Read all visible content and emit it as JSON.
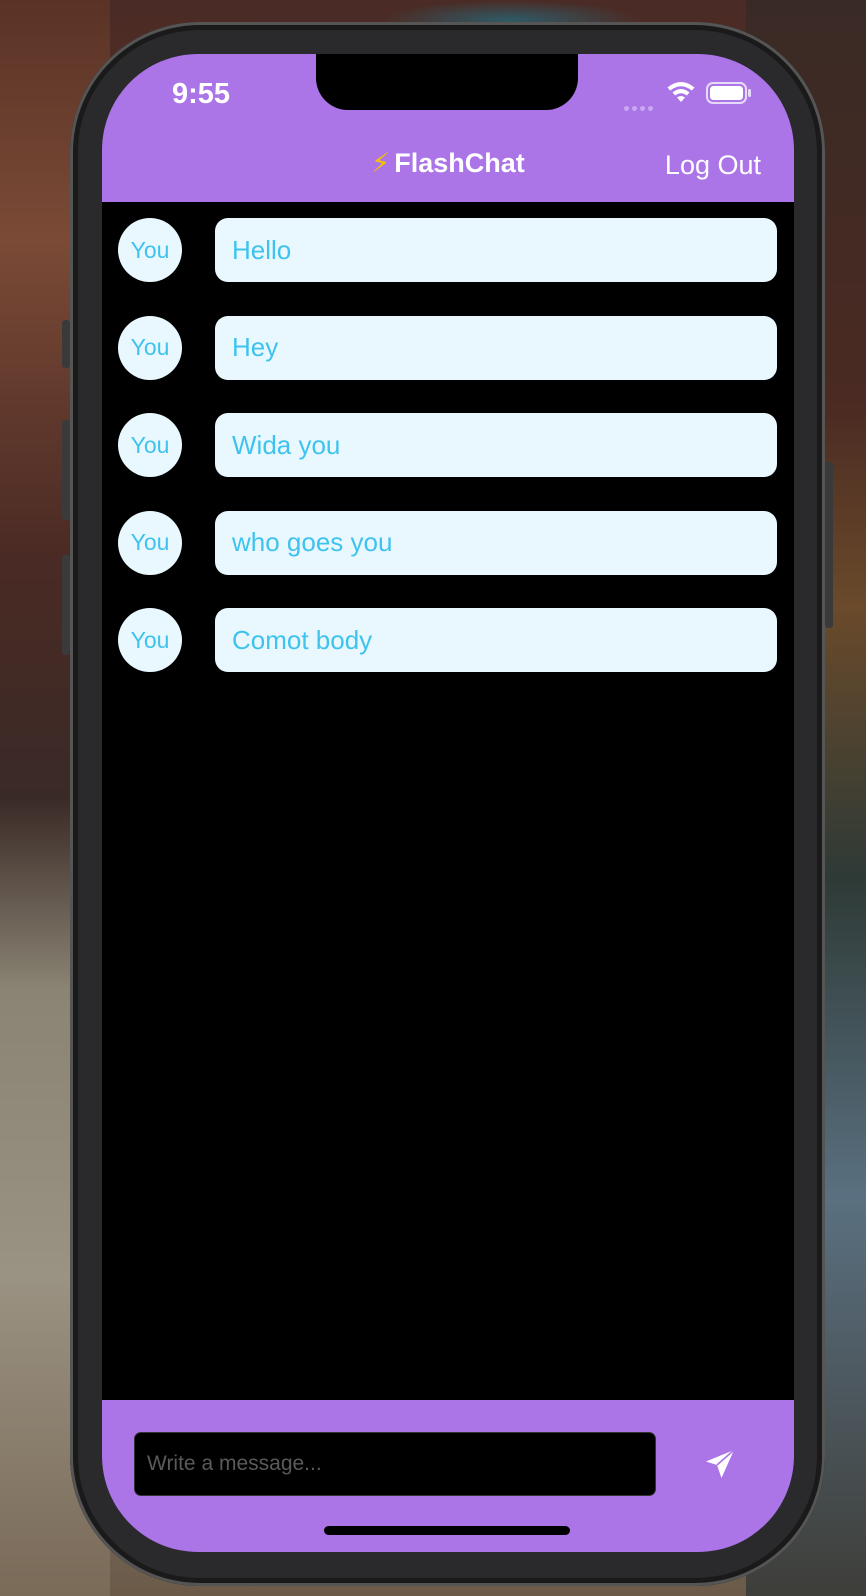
{
  "status_bar": {
    "time": "9:55",
    "wifi_icon": "wifi-icon",
    "battery_icon": "battery-icon"
  },
  "header": {
    "title_icon": "⚡",
    "title": "FlashChat",
    "logout_label": "Log Out"
  },
  "messages": [
    {
      "sender": "You",
      "text": "Hello"
    },
    {
      "sender": "You",
      "text": "Hey"
    },
    {
      "sender": "You",
      "text": "Wida you"
    },
    {
      "sender": "You",
      "text": "who goes you"
    },
    {
      "sender": "You",
      "text": "Comot body"
    }
  ],
  "composer": {
    "placeholder": "Write a message...",
    "value": "",
    "send_icon": "paper-plane-icon"
  },
  "colors": {
    "accent": "#ab75e8",
    "bubble_bg": "#e9f8fe",
    "bubble_text": "#3fc3ee",
    "chat_bg": "#000000"
  }
}
